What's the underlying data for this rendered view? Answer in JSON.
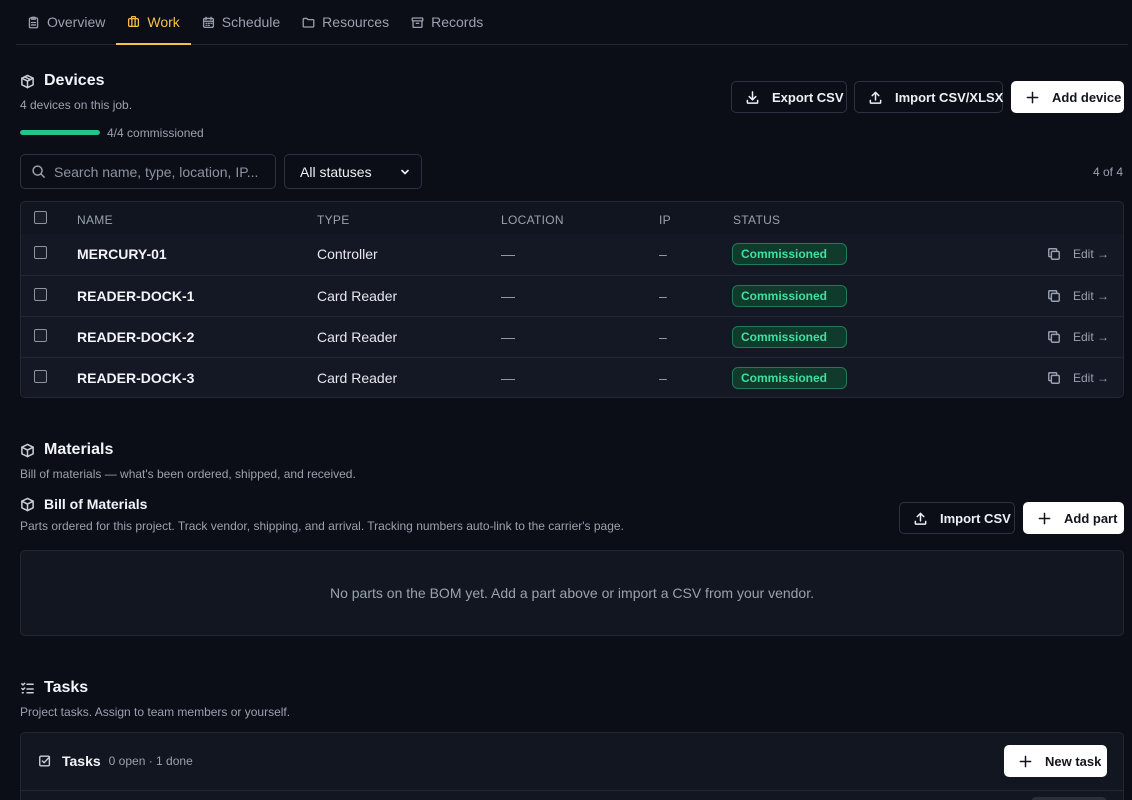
{
  "tabs": [
    {
      "label": "Overview",
      "icon": "clipboard-icon"
    },
    {
      "label": "Work",
      "icon": "briefcase-icon"
    },
    {
      "label": "Schedule",
      "icon": "calendar-icon"
    },
    {
      "label": "Resources",
      "icon": "folder-icon"
    },
    {
      "label": "Records",
      "icon": "archive-icon"
    }
  ],
  "active_tab": "Work",
  "devices": {
    "title": "Devices",
    "subtitle": "4 devices on this job.",
    "progress_text": "4/4 commissioned",
    "progress_fraction": 1.0,
    "export_label": "Export CSV",
    "import_label": "Import CSV/XLSX",
    "add_label": "Add device",
    "search_placeholder": "Search name, type, location, IP...",
    "status_filter": "All statuses",
    "count_text": "4 of 4",
    "columns": {
      "name": "NAME",
      "type": "TYPE",
      "location": "LOCATION",
      "ip": "IP",
      "status": "STATUS"
    },
    "rows": [
      {
        "name": "MERCURY-01",
        "type": "Controller",
        "location": "—",
        "ip": "–",
        "status": "Commissioned",
        "edit": "Edit →"
      },
      {
        "name": "READER-DOCK-1",
        "type": "Card Reader",
        "location": "—",
        "ip": "–",
        "status": "Commissioned",
        "edit": "Edit →"
      },
      {
        "name": "READER-DOCK-2",
        "type": "Card Reader",
        "location": "—",
        "ip": "–",
        "status": "Commissioned",
        "edit": "Edit →"
      },
      {
        "name": "READER-DOCK-3",
        "type": "Card Reader",
        "location": "—",
        "ip": "–",
        "status": "Commissioned",
        "edit": "Edit →"
      }
    ]
  },
  "materials": {
    "title": "Materials",
    "subtitle": "Bill of materials — what's been ordered, shipped, and received.",
    "bom_title": "Bill of Materials",
    "bom_subtitle": "Parts ordered for this project. Track vendor, shipping, and arrival. Tracking numbers auto-link to the carrier's page.",
    "import_label": "Import CSV",
    "add_label": "Add part",
    "empty_text": "No parts on the BOM yet. Add a part above or import a CSV from your vendor."
  },
  "tasks": {
    "title": "Tasks",
    "subtitle": "Project tasks. Assign to team members or yourself.",
    "card_title": "Tasks",
    "card_count": "0 open · 1 done",
    "new_label": "New task"
  },
  "colors": {
    "background": "#0b0e17",
    "accent": "#f5c144",
    "success": "#22c48a",
    "badge_text": "#3fe0a0"
  }
}
